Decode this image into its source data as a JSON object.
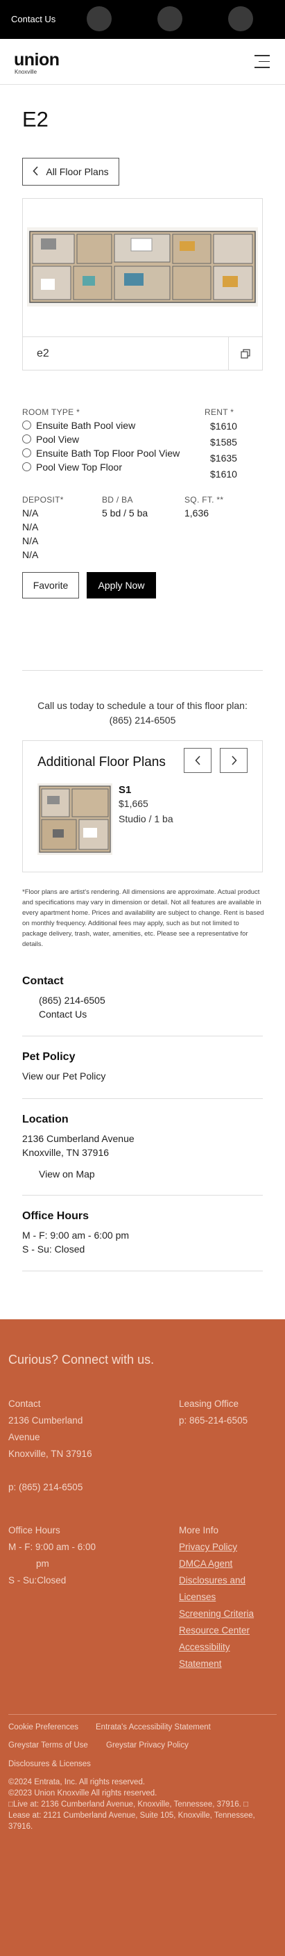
{
  "topbar": {
    "contact_label": "Contact Us",
    "dots": 3
  },
  "header": {
    "logo_text": "union",
    "logo_sub": "Knoxville"
  },
  "page_title": "E2",
  "back_button": "All Floor Plans",
  "floorplan": {
    "name": "e2"
  },
  "room_types": {
    "header": "ROOM TYPE *",
    "rent_header": "RENT *",
    "rows": [
      {
        "name": "Ensuite Bath Pool view",
        "rent": "$1610"
      },
      {
        "name": "Pool View",
        "rent": "$1585"
      },
      {
        "name": "Ensuite Bath Top Floor Pool View",
        "rent": "$1635"
      },
      {
        "name": "Pool View Top Floor",
        "rent": "$1610"
      }
    ]
  },
  "details": {
    "deposit_header": "DEPOSIT*",
    "bdba_header": "BD / BA",
    "sqft_header": "SQ. FT. **",
    "deposits": [
      "N/A",
      "N/A",
      "N/A",
      "N/A"
    ],
    "bdba": "5 bd / 5 ba",
    "sqft": "1,636"
  },
  "actions": {
    "favorite": "Favorite",
    "apply": "Apply Now"
  },
  "call": {
    "line1": "Call us today to schedule a tour of this floor plan:",
    "phone": "(865) 214-6505"
  },
  "additional": {
    "title": "Additional Floor Plans",
    "item": {
      "name": "S1",
      "price": "$1,665",
      "beds": "Studio / 1 ba"
    }
  },
  "disclaimer": "*Floor plans are artist's rendering. All dimensions are approximate. Actual product and specifications may vary in dimension or detail. Not all features are available in every apartment home. Prices and availability are subject to change. Rent is based on monthly frequency. Additional fees may apply, such as but not limited to package delivery, trash, water, amenities, etc. Please see a representative for details.",
  "contact": {
    "title": "Contact",
    "phone": "(865) 214-6505",
    "link": "Contact Us"
  },
  "pet": {
    "title": "Pet Policy",
    "link": "View our Pet Policy"
  },
  "location": {
    "title": "Location",
    "line1": "2136 Cumberland Avenue",
    "line2": "Knoxville, TN 37916",
    "link": "View on Map"
  },
  "hours": {
    "title": "Office Hours",
    "line1": "M - F:  9:00 am - 6:00 pm",
    "line2": "S - Su:  Closed"
  },
  "footer": {
    "heading": "Curious? Connect with us.",
    "contact_label": "Contact",
    "address1": "2136 Cumberland",
    "address2": "Avenue",
    "address3": "Knoxville, TN 37916",
    "phone": "p: (865) 214-6505",
    "leasing_label": "Leasing Office",
    "leasing_phone": "p: 865-214-6505",
    "hours_label": "Office Hours",
    "hours1": "M - F: 9:00 am - 6:00",
    "hours1b": "pm",
    "hours2": "S - Su:Closed",
    "more_label": "More Info",
    "links": [
      "Privacy Policy",
      "DMCA Agent",
      "Disclosures and",
      "Licenses",
      "Screening Criteria",
      "Resource Center",
      "Accessibility",
      "Statement"
    ],
    "bottom_links": [
      "Cookie Preferences",
      "Entrata's Accessibility Statement",
      "Greystar Terms of Use",
      "Greystar Privacy Policy",
      "Disclosures & Licenses"
    ],
    "copy1": "©2024 Entrata, Inc. All rights reserved.",
    "copy2": "©2023 Union Knoxville All rights reserved.",
    "copy3": "□Live at: 2136 Cumberland Avenue, Knoxville, Tennessee, 37916. □",
    "copy4": "Lease at: 2121 Cumberland Avenue, Suite 105, Knoxville, Tennessee,",
    "copy5": "37916."
  },
  "colors": {
    "footer_bg": "#c35f3b",
    "topbar_bg": "#000000",
    "apply_bg": "#000000"
  }
}
